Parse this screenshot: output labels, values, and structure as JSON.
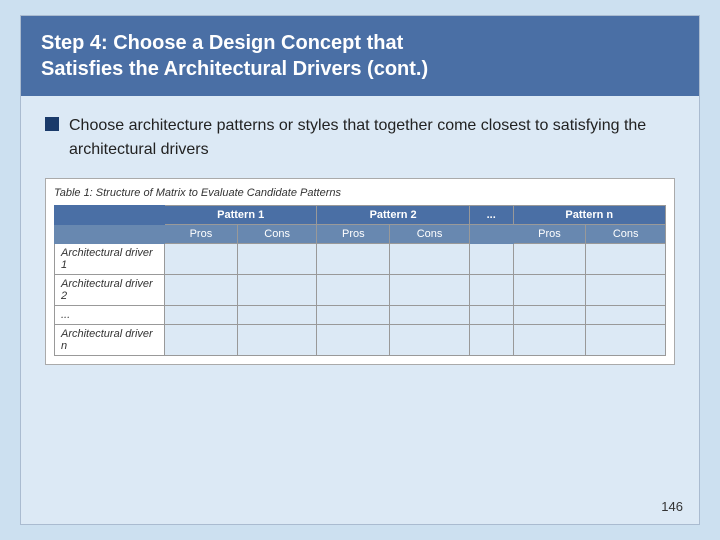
{
  "slide": {
    "title_line1": "Step 4: Choose a Design Concept that",
    "title_line2": "Satisfies the Architectural Drivers (cont.)",
    "bullet_text": "Choose architecture patterns or styles that together come closest to satisfying the architectural drivers",
    "table": {
      "caption": "Table 1:    Structure of Matrix to Evaluate Candidate Patterns",
      "col_headers": [
        "Pattern 1",
        "Pattern 2",
        "...",
        "Pattern n"
      ],
      "sub_headers": [
        "Pros",
        "Cons",
        "Pros",
        "Cons",
        "Pros",
        "Cons"
      ],
      "rows": [
        {
          "label": "Architectural driver 1",
          "cells": 6
        },
        {
          "label": "Architectural driver 2",
          "cells": 6
        },
        {
          "label": "...",
          "cells": 6
        },
        {
          "label": "Architectural driver n",
          "cells": 6
        }
      ]
    },
    "page_number": "146"
  }
}
